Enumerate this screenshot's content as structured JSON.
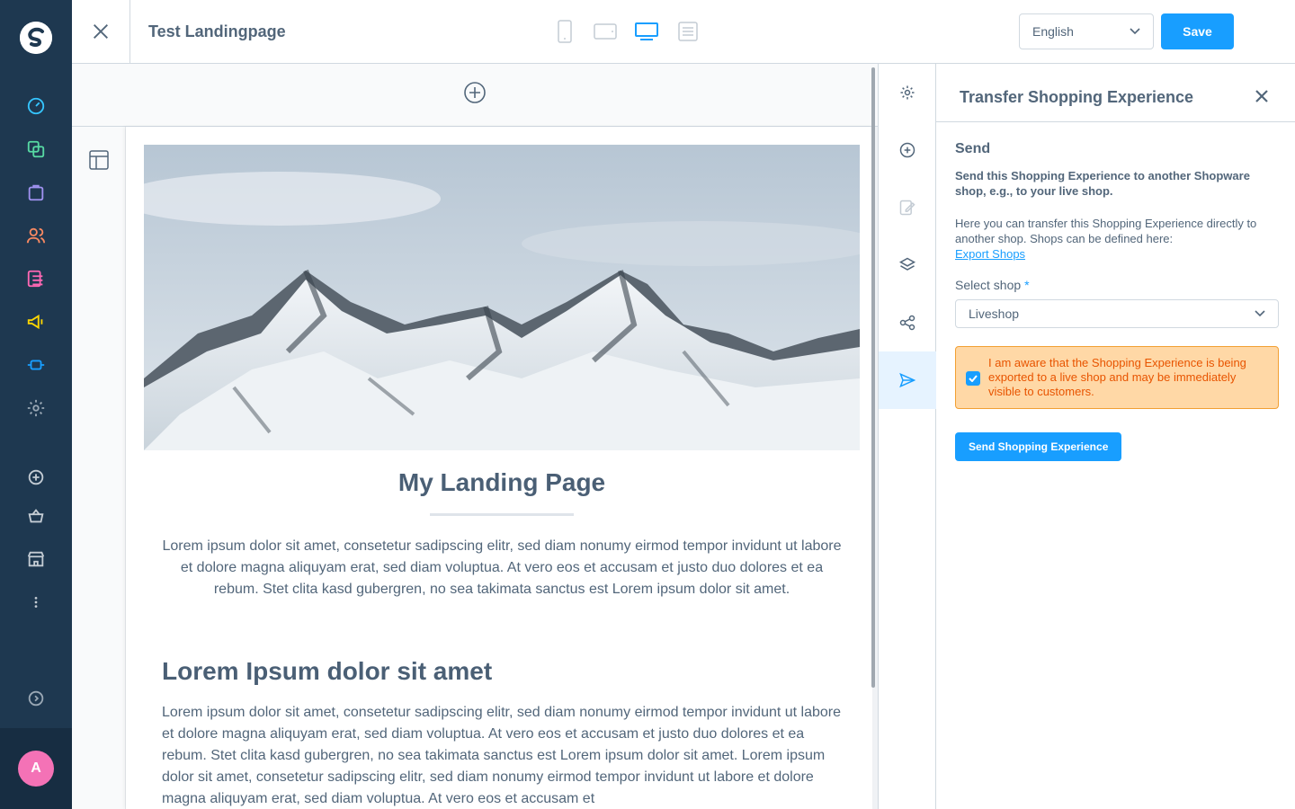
{
  "app": {
    "page_title": "Test Landingpage",
    "language": "English",
    "save_label": "Save"
  },
  "colors": {
    "sidebar_bg": "#1e3850",
    "accent": "#189eff",
    "warning_bg": "#ffd8a6",
    "warning_text": "#e85400",
    "avatar_bg": "#f472b6"
  },
  "sidebar": {
    "items": [
      {
        "icon": "dashboard-icon",
        "color": "#35c5ff"
      },
      {
        "icon": "catalogue-icon",
        "color": "#57d9a3"
      },
      {
        "icon": "orders-icon",
        "color": "#a092f0"
      },
      {
        "icon": "customers-icon",
        "color": "#f88962"
      },
      {
        "icon": "content-icon",
        "color": "#ff68b4"
      },
      {
        "icon": "marketing-icon",
        "color": "#ffd700"
      },
      {
        "icon": "extensions-icon",
        "color": "#189eff"
      },
      {
        "icon": "settings-icon",
        "color": "#9aa8b5"
      }
    ],
    "secondary": [
      "add-icon",
      "basket-icon",
      "store-icon",
      "more-icon"
    ],
    "collapse_icon": "chevron-right-circle-icon",
    "avatar_initial": "A"
  },
  "devices": [
    "mobile-icon",
    "tablet-icon",
    "desktop-icon",
    "form-icon"
  ],
  "canvas": {
    "landing_title": "My Landing Page",
    "intro_text": "Lorem ipsum dolor sit amet, consetetur sadipscing elitr, sed diam nonumy eirmod tempor invidunt ut labore et dolore magna aliquyam erat, sed diam voluptua. At vero eos et accusam et justo duo dolores et ea rebum. Stet clita kasd gubergren, no sea takimata sanctus est Lorem ipsum dolor sit amet.",
    "sub_heading": "Lorem Ipsum dolor sit amet",
    "body_text": "Lorem ipsum dolor sit amet, consetetur sadipscing elitr, sed diam nonumy eirmod tempor invidunt ut labore et dolore magna aliquyam erat, sed diam voluptua. At vero eos et accusam et justo duo dolores et ea rebum. Stet clita kasd gubergren, no sea takimata sanctus est Lorem ipsum dolor sit amet. Lorem ipsum dolor sit amet, consetetur sadipscing elitr, sed diam nonumy eirmod tempor invidunt ut labore et dolore magna aliquyam erat, sed diam voluptua. At vero eos et accusam et"
  },
  "tabs": [
    "settings-icon",
    "add-block-icon",
    "edit-icon",
    "layers-icon",
    "share-icon",
    "send-icon"
  ],
  "panel": {
    "title": "Transfer Shopping Experience",
    "section_title": "Send",
    "lead": "Send this Shopping Experience to another Shopware shop, e.g., to your live shop.",
    "desc": "Here you can transfer this Shopping Experience directly to another shop. Shops can be defined here:",
    "link": "Export Shops",
    "shop_label": "Select shop",
    "shop_required": "*",
    "shop_value": "Liveshop",
    "warning": "I am aware that the Shopping Experience is being exported to a live shop and may be immediately visible to customers.",
    "send_label": "Send Shopping Experience"
  }
}
